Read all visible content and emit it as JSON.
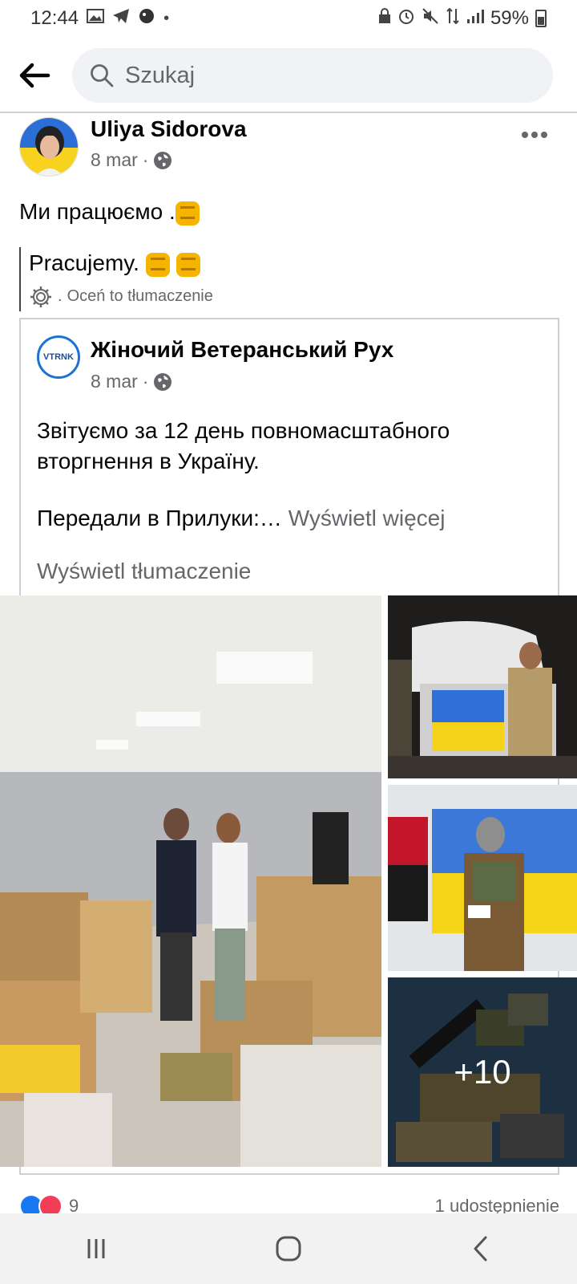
{
  "status_bar": {
    "time": "12:44",
    "battery": "59%"
  },
  "search": {
    "placeholder": "Szukaj"
  },
  "post": {
    "author": "Uliya Sidorova",
    "date": "8 mar",
    "separator": "·",
    "text": "Ми працюємо .",
    "translation": "Pracujemy.",
    "rate_translation": "Oceń to tłumaczenie",
    "rate_dot": "."
  },
  "shared_post": {
    "page_avatar_text": "VTRNK",
    "page_name": "Жіночий Ветеранський Рух",
    "date": "8 mar",
    "text_line1": "Звітуємо за 12 день повномасштабного вторгнення в Україну.",
    "text_line3": "Передали в Прилуки:…",
    "see_more": "Wyświetl więcej",
    "see_translation": "Wyświetl tłumaczenie",
    "more_photos": "+10"
  },
  "reactions": {
    "count": "9",
    "shares": "1 udostępnienie"
  },
  "colors": {
    "facebook_blue": "#1877f2",
    "love_red": "#f33e58",
    "secondary_text": "#65676b"
  }
}
